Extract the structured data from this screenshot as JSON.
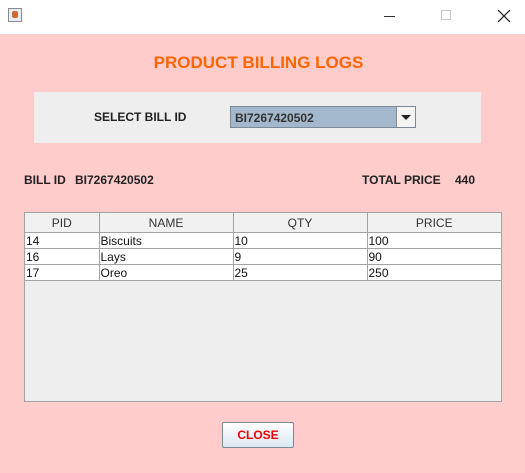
{
  "window": {
    "icon": "java-cup-icon",
    "controls": [
      "minimize-icon",
      "maximize-icon",
      "close-icon"
    ]
  },
  "page": {
    "title": "PRODUCT BILLING LOGS"
  },
  "select": {
    "label": "SELECT BILL ID",
    "value": "BI7267420502"
  },
  "summary": {
    "bill_label": "BILL ID",
    "bill_value": "BI7267420502",
    "total_label": "TOTAL PRICE",
    "total_value": "440"
  },
  "table": {
    "headers": [
      "PID",
      "NAME",
      "QTY",
      "PRICE"
    ],
    "rows": [
      [
        "14",
        "Biscuits",
        "10",
        "100"
      ],
      [
        "16",
        "Lays",
        "9",
        "90"
      ],
      [
        "17",
        "Oreo",
        "25",
        "250"
      ]
    ]
  },
  "actions": {
    "close_label": "CLOSE"
  },
  "colors": {
    "background": "#ffcccc",
    "title": "#ff6600",
    "close_text": "#ee0000",
    "combo": "#a3b8cc"
  }
}
